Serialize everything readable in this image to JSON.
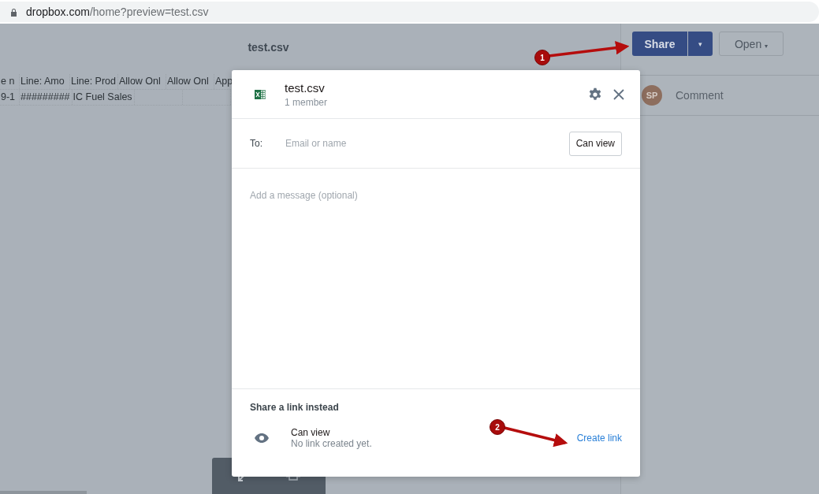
{
  "address_bar": {
    "domain": "dropbox.com",
    "path": "/home?preview=test.csv"
  },
  "preview": {
    "title": "test.csv",
    "header_cells": [
      "e n",
      "Line: Amo",
      "Line: Prod",
      "Allow Onl",
      "Allow Onl",
      "App"
    ],
    "row_cells": [
      "9-1",
      "#########",
      "IC Fuel Sales",
      "",
      "",
      ""
    ]
  },
  "side_panel": {
    "share_button": "Share",
    "share_menu": "▾",
    "open_button": "Open",
    "open_caret": "▾",
    "avatar_initials": "SP",
    "comment_placeholder": "Comment"
  },
  "dialog": {
    "title": "test.csv",
    "subtitle": "1 member",
    "to_label": "To:",
    "to_placeholder": "Email or name",
    "permission_button": "Can view",
    "message_placeholder": "Add a message (optional)",
    "link_heading": "Share a link instead",
    "link_permission": "Can view",
    "link_status": "No link created yet.",
    "create_link": "Create link"
  },
  "annotations": [
    {
      "number": "1"
    },
    {
      "number": "2"
    }
  ]
}
